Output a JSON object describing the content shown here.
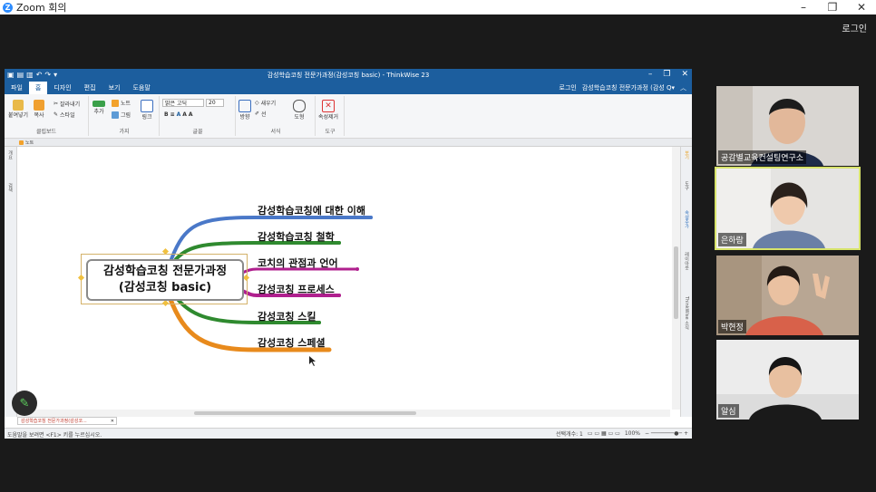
{
  "zoom": {
    "title": "Zoom 회의",
    "login": "로그인"
  },
  "app": {
    "window_title": "감성학습코칭 전문가과정(감성코칭 basic) - ThinkWise 23",
    "menu_tabs": [
      "파일",
      "홈",
      "디자인",
      "편집",
      "보기",
      "도움말"
    ],
    "active_tab": "홈",
    "menu_right": [
      "로그인",
      "감성학습코칭 전문가과정 (감성 Q▾"
    ],
    "ribbon": {
      "clipboard": {
        "paste": "붙여넣기",
        "copy": "복사",
        "cut": "잘라내기",
        "style": "스타일",
        "label": "클립보드"
      },
      "branch": {
        "add": "추가",
        "note": "노트",
        "picture": "그림",
        "link": "링크",
        "label": "가지"
      },
      "font": {
        "family": "맑은 고딕",
        "size": "20",
        "label": "글꼴"
      },
      "format": {
        "layout": "방향",
        "new": "새우기",
        "line": "선",
        "shape": "도형",
        "label": "서식"
      },
      "tools": {
        "remove": "속성제거",
        "label": "도구"
      }
    },
    "doc_tab": "노트",
    "left_strip": [
      "개요",
      "검색"
    ],
    "right_strip": [
      "보기",
      "도구",
      "속성추가",
      "레이아웃",
      "ThinkWise 소식"
    ],
    "mindmap": {
      "central": [
        "감성학습코칭 전문가과정",
        "(감성코칭 basic)"
      ],
      "branches": [
        {
          "label": "감성학습코칭에 대한 이해",
          "color": "#4a78c8"
        },
        {
          "label": "감성학습코칭 철학",
          "color": "#2f8a2f"
        },
        {
          "label": "코치의 관점과 언어",
          "color": "#b0208e"
        },
        {
          "label": "감성코칭 프로세스",
          "color": "#b0208e"
        },
        {
          "label": "감성코칭 스킬",
          "color": "#2f8a2f"
        },
        {
          "label": "감성코칭 스페셜",
          "color": "#e88a1c"
        }
      ]
    },
    "bottom_tab": "감성학습코칭 전문가과정(감성코...",
    "status": {
      "hint": "도움말을 보려면 <F1> 키를 누르십시오.",
      "selection": "선택개수: 1",
      "zoom": "100%"
    }
  },
  "participants": [
    {
      "name": "공감별교육컨설팅연구소",
      "bg": "#d9d6d2",
      "shirt": "#1f2c4a",
      "active": false
    },
    {
      "name": "은하람",
      "bg": "#e5e4e2",
      "shirt": "#6a7fa6",
      "active": true
    },
    {
      "name": "박현정",
      "bg": "#b8a693",
      "shirt": "#d8614a",
      "active": false
    },
    {
      "name": "알심",
      "bg": "#ececec",
      "shirt": "#1a1a1a",
      "active": false
    }
  ]
}
